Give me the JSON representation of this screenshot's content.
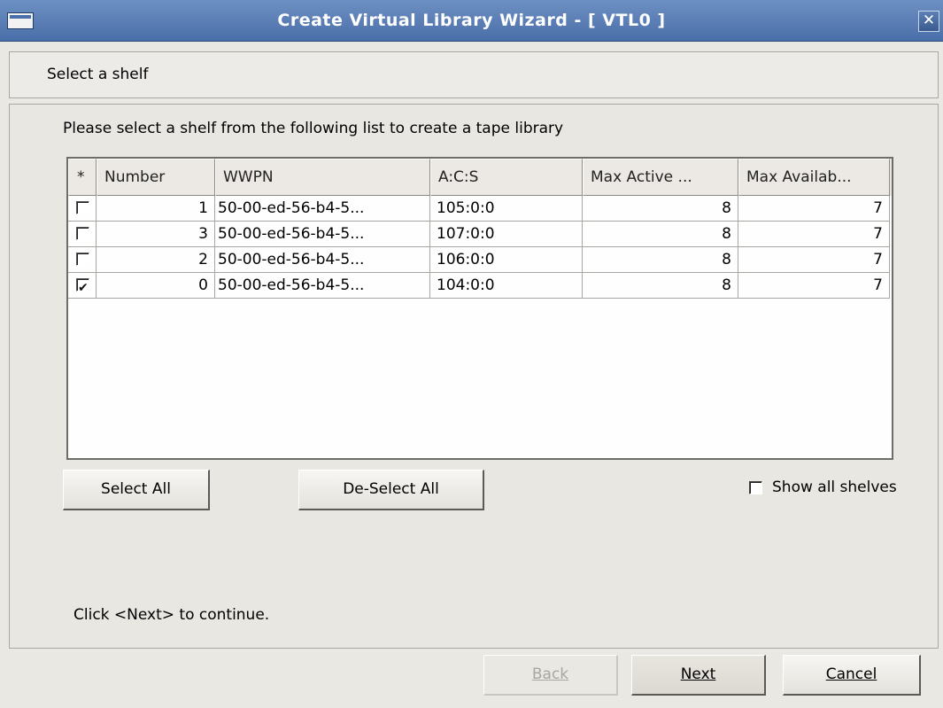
{
  "window": {
    "title": "Create Virtual Library Wizard - [ VTL0 ]",
    "close_glyph": "✕"
  },
  "header": {
    "label": "Select a shelf"
  },
  "instruction": "Please select a shelf from the following list to create a tape library",
  "table": {
    "columns": [
      "*",
      "Number",
      "WWPN",
      "A:C:S",
      "Max Active ...",
      "Max Availab..."
    ],
    "rows": [
      {
        "checked": false,
        "number": "1",
        "wwpn": "50-00-ed-56-b4-5...",
        "acs": "105:0:0",
        "max_active": "8",
        "max_available": "7"
      },
      {
        "checked": false,
        "number": "3",
        "wwpn": "50-00-ed-56-b4-5...",
        "acs": "107:0:0",
        "max_active": "8",
        "max_available": "7"
      },
      {
        "checked": false,
        "number": "2",
        "wwpn": "50-00-ed-56-b4-5...",
        "acs": "106:0:0",
        "max_active": "8",
        "max_available": "7"
      },
      {
        "checked": true,
        "number": "0",
        "wwpn": "50-00-ed-56-b4-5...",
        "acs": "104:0:0",
        "max_active": "8",
        "max_available": "7"
      }
    ]
  },
  "buttons": {
    "select_all": "Select All",
    "deselect_all": "De-Select All",
    "back": "Back",
    "next": "Next",
    "cancel": "Cancel"
  },
  "show_all_shelves": {
    "label": "Show all shelves",
    "checked": false
  },
  "footer_note": "Click <Next> to continue.",
  "colors": {
    "titlebar": "#5a7fb8",
    "window_bg": "#eae8e3",
    "table_bg": "#fefefe"
  }
}
